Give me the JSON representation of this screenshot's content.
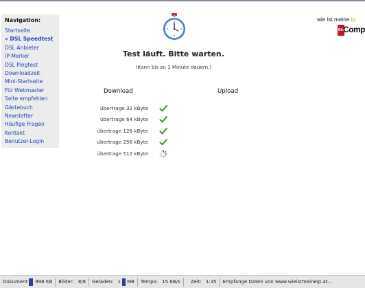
{
  "sidebar": {
    "heading": "Navigation:",
    "items": [
      {
        "label": "Startseite"
      },
      {
        "label": "» DSL Speedtest",
        "active": true
      },
      {
        "label": "DSL Anbieter"
      },
      {
        "label": "IP-Merker"
      },
      {
        "label": "DSL Pingtest"
      },
      {
        "label": "Downloadzeit"
      },
      {
        "label": "Mini-Startseite"
      },
      {
        "label": "Für Webmaster"
      },
      {
        "label": "Seite empfehlen"
      },
      {
        "label": "Gästebuch"
      },
      {
        "label": "Newsletter"
      },
      {
        "label": "Häufige Fragen"
      },
      {
        "label": "Kontakt"
      },
      {
        "label": "Benutzer-Login"
      }
    ]
  },
  "header": {
    "stopwatch_icon": "stopwatch-icon",
    "logo": {
      "line1": "wie ist meine ",
      "line1_accent": "ip",
      "wordmark": "Compu",
      "badge": "Bild"
    }
  },
  "main": {
    "headline": "Test läuft. Bitte warten.",
    "subline": "(Kann bis zu 1 Minute dauern.)",
    "download_heading": "Download",
    "upload_heading": "Upload",
    "rows": [
      {
        "label": "übertrage 32 kByte",
        "status": "done"
      },
      {
        "label": "übertrage 64 kByte",
        "status": "done"
      },
      {
        "label": "übertrage 128 kByte",
        "status": "done"
      },
      {
        "label": "übertrage 256 kByte",
        "status": "done"
      },
      {
        "label": "übertrage 512 kByte",
        "status": "loading"
      }
    ],
    "colors": {
      "check": "#2fa51e",
      "link": "#1d46b8"
    }
  },
  "statusbar": {
    "dokument_label": "Dokument",
    "dokument_value": "998 KB",
    "bilder_label": "Bilder:",
    "bilder_value": "8/8",
    "geladen_label": "Geladen:",
    "geladen_value": "1",
    "geladen_unit": "MB",
    "tempo_label": "Tempo:",
    "tempo_value": "15 KB/s",
    "zeit_label": "Zeit:",
    "zeit_value": "1:35",
    "message": "Empfange Daten von www.wieistmeineip.at..."
  }
}
